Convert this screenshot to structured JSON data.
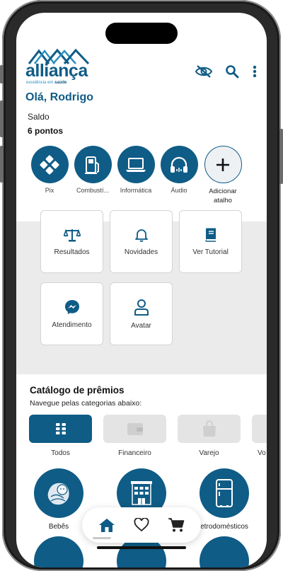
{
  "brand": {
    "name": "alliança",
    "tagline_prefix": "excelência em ",
    "tagline_bold": "saúde",
    "primary_color": "#0f5c86"
  },
  "header": {
    "icons": [
      "eye-off-icon",
      "search-icon",
      "more-vertical-icon"
    ]
  },
  "greeting": "Olá, Rodrigo",
  "balance": {
    "label": "Saldo",
    "value": "6 pontos"
  },
  "shortcuts": [
    {
      "label": "Pix",
      "icon": "pix-icon"
    },
    {
      "label": "Combustí...",
      "icon": "fuel-icon"
    },
    {
      "label": "Informática",
      "icon": "laptop-icon"
    },
    {
      "label": "Áudio",
      "icon": "headphones-icon"
    },
    {
      "label": "Adicionar atalho",
      "icon": "plus-icon"
    }
  ],
  "cards": [
    {
      "label": "Resultados",
      "icon": "scale-icon"
    },
    {
      "label": "Novidades",
      "icon": "bell-icon"
    },
    {
      "label": "Ver Tutorial",
      "icon": "book-icon"
    },
    {
      "label": "Atendimento",
      "icon": "messenger-icon"
    },
    {
      "label": "Avatar",
      "icon": "user-icon"
    }
  ],
  "catalog": {
    "title": "Catálogo de prêmios",
    "subtitle": "Navegue pelas categorias abaixo:",
    "tabs": [
      {
        "label": "Todos",
        "active": true,
        "icon": "grid-icon"
      },
      {
        "label": "Financeiro",
        "active": false,
        "icon": "wallet-icon"
      },
      {
        "label": "Varejo",
        "active": false,
        "icon": "shopping-bag-icon"
      },
      {
        "label": "Vo",
        "active": false,
        "icon": "unknown-icon"
      }
    ],
    "categories": [
      {
        "label": "Bebês",
        "icon": "baby-icon"
      },
      {
        "label": "",
        "icon": "building-icon"
      },
      {
        "label": "etrodomésticos",
        "icon": "refrigerator-icon"
      }
    ]
  },
  "bottom_nav": [
    {
      "name": "home",
      "icon": "home-icon",
      "active": true
    },
    {
      "name": "favorites",
      "icon": "heart-icon",
      "active": false
    },
    {
      "name": "cart",
      "icon": "cart-icon",
      "active": false
    }
  ]
}
